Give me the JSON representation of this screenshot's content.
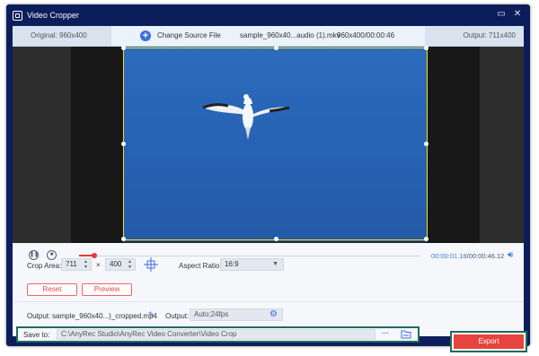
{
  "window": {
    "title": "Video Cropper",
    "minimize_glyph": "▭",
    "close_glyph": "✕"
  },
  "info_bar": {
    "original": "Original: 960x400",
    "change_source": "Change Source File",
    "file_name": "sample_960x40...audio (1).mkv",
    "file_info": "960x400/00:00:46",
    "output": "Output: 711x400"
  },
  "player": {
    "current_time": "00:00:01.18",
    "total_time": "/00:00:46.12",
    "progress_fraction": 0.04
  },
  "crop": {
    "crop_area_label": "Crop Area:",
    "width": "711",
    "times": "×",
    "height": "400",
    "aspect_label": "Aspect Ratio:",
    "aspect_value": "16:9",
    "reset_label": "Reset",
    "preview_label": "Preview"
  },
  "output": {
    "output_label": "Output:",
    "output_file": "sample_960x40...)_cropped.mp4",
    "output_label2": "Output:",
    "output_format": "Auto;24fps"
  },
  "save": {
    "save_label": "Save to:",
    "path": "C:\\AnyRec Studio\\AnyRec Video Converter\\Video Crop",
    "more_glyph": "···"
  },
  "export_label": "Export",
  "colors": {
    "accent": "#3f6ce0",
    "export": "#e8443f",
    "window": "#0b1e5b",
    "crop_border": "#f2e21a"
  }
}
